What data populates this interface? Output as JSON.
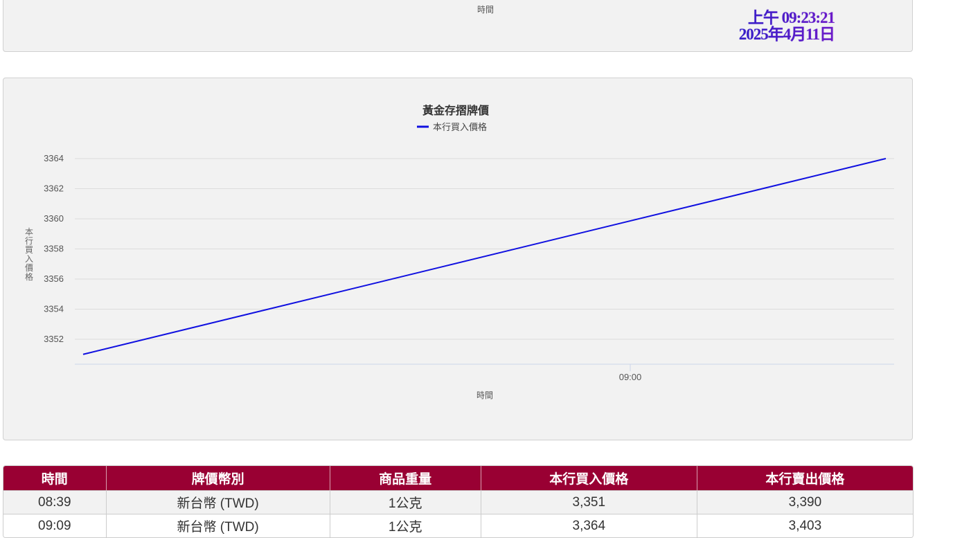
{
  "top_panel": {
    "axis_label": "時間"
  },
  "clock": {
    "time": "上午 09:23:21",
    "date": "2025年4月11日"
  },
  "chart_data": {
    "type": "line",
    "title": "黃金存摺牌價",
    "legend": [
      "本行買入價格"
    ],
    "legend_position": "top-center",
    "xlabel": "時間",
    "ylabel": "本行買入價格",
    "x": [
      "08:39",
      "09:09"
    ],
    "x_ticks": [
      "09:00"
    ],
    "series": [
      {
        "name": "本行買入價格",
        "values": [
          3351,
          3364
        ],
        "color": "#1010e0"
      }
    ],
    "y_ticks": [
      3352,
      3354,
      3356,
      3358,
      3360,
      3362,
      3364
    ],
    "ylim": [
      3350,
      3365
    ],
    "grid": true
  },
  "table": {
    "headers": [
      "時間",
      "牌價幣別",
      "商品重量",
      "本行買入價格",
      "本行賣出價格"
    ],
    "rows": [
      [
        "08:39",
        "新台幣 (TWD)",
        "1公克",
        "3,351",
        "3,390"
      ],
      [
        "09:09",
        "新台幣 (TWD)",
        "1公克",
        "3,364",
        "3,403"
      ]
    ]
  },
  "colors": {
    "header_bg": "#990033",
    "line": "#1010e0"
  }
}
